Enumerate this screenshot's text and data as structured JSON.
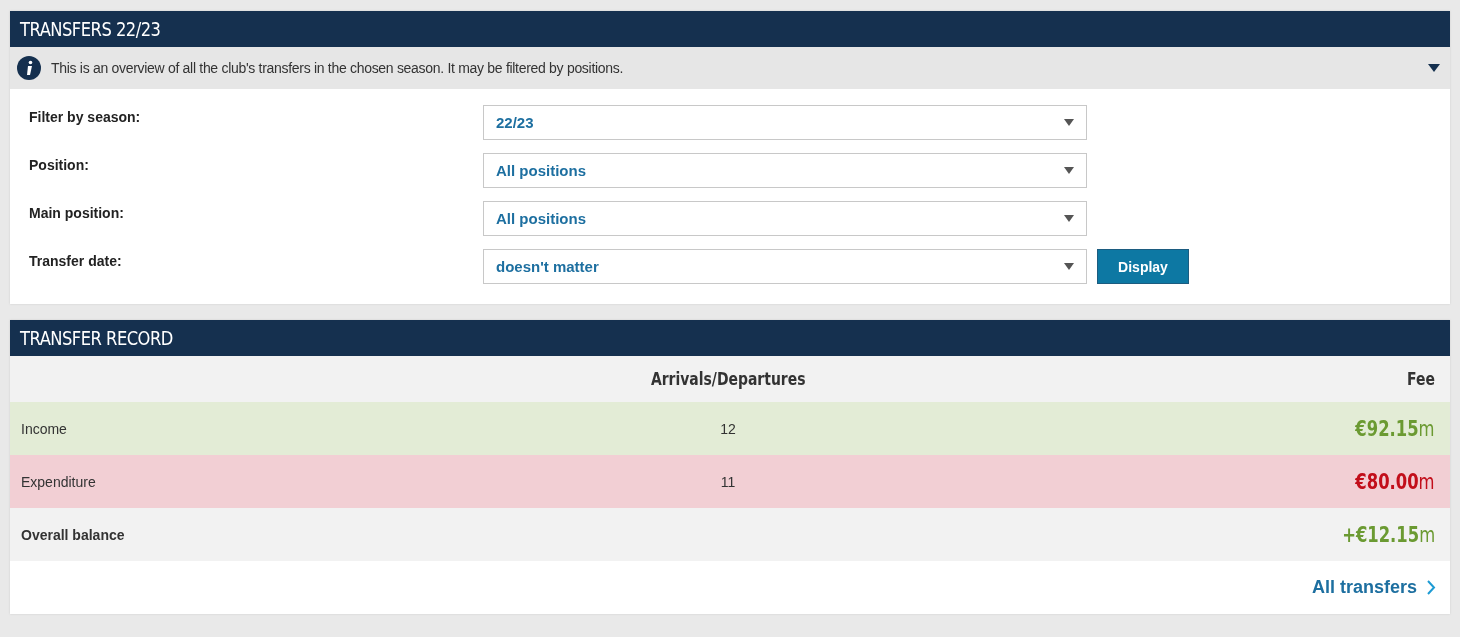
{
  "filters_panel": {
    "title": "TRANSFERS 22/23",
    "info": "This is an overview of all the club's transfers in the chosen season. It may be filtered by positions.",
    "info_expanded": false,
    "filters": [
      {
        "label": "Filter by season:",
        "value": "22/23"
      },
      {
        "label": "Position:",
        "value": "All positions"
      },
      {
        "label": "Main position:",
        "value": "All positions"
      },
      {
        "label": "Transfer date:",
        "value": "doesn't matter"
      }
    ],
    "button": "Display"
  },
  "record_panel": {
    "title": "TRANSFER RECORD",
    "columns": [
      "Arrivals/Departures",
      "Fee"
    ],
    "rows": [
      {
        "kind": "income",
        "label": "Income",
        "count": "12",
        "fee": "**€92.15**m"
      },
      {
        "kind": "expenditure",
        "label": "Expenditure",
        "count": "11",
        "fee": "**€80.00**m"
      },
      {
        "kind": "balance",
        "label": "Overall balance",
        "fee": "**+€12.15**m"
      }
    ],
    "link": "All transfers"
  }
}
